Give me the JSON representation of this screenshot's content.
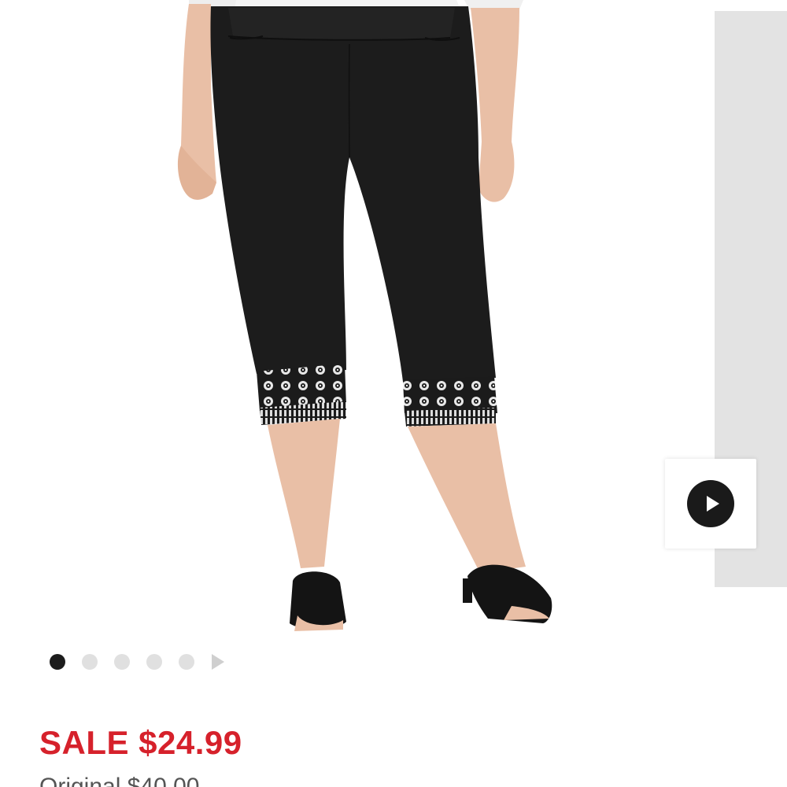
{
  "product": {
    "image_alt": "Black cropped capri pants with white embroidered hem",
    "video_button_icon": "play-icon"
  },
  "gallery": {
    "dots": [
      {
        "active": true
      },
      {
        "active": false
      },
      {
        "active": false
      },
      {
        "active": false
      },
      {
        "active": false
      }
    ],
    "next_icon": "chevron-right-icon"
  },
  "pricing": {
    "sale_label": "SALE $24.99",
    "original_label": "Original $40.00",
    "sale_color": "#d6212b"
  }
}
